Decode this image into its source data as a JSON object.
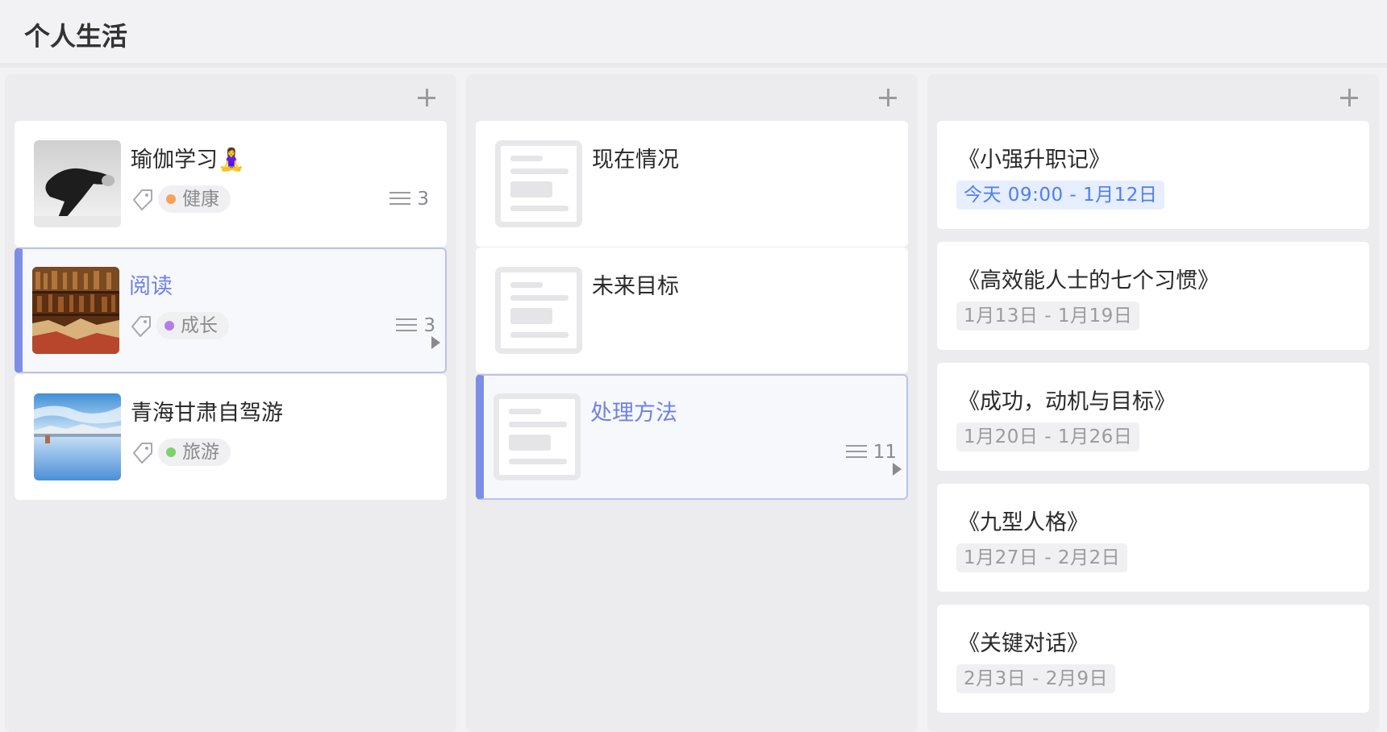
{
  "header": {
    "title": "个人生活"
  },
  "colors": {
    "accent": "#7d8ee6",
    "health": "#f5a35a",
    "growth": "#b27de8",
    "travel": "#7bd36a",
    "today_blue": "#4d7ff0"
  },
  "columns": [
    {
      "add_icon": "plus-icon",
      "cards": [
        {
          "title": "瑜伽学习🧘‍♀️",
          "tag": "健康",
          "count": "3",
          "selected": false,
          "image": "yoga-photo"
        },
        {
          "title": "阅读",
          "tag": "成长",
          "count": "3",
          "selected": true,
          "image": "bookshelf-photo"
        },
        {
          "title": "青海甘肃自驾游",
          "tag": "旅游",
          "count": "",
          "selected": false,
          "image": "lake-photo"
        }
      ]
    },
    {
      "add_icon": "plus-icon",
      "cards": [
        {
          "title": "现在情况",
          "count": "",
          "selected": false,
          "image": "placeholder"
        },
        {
          "title": "未来目标",
          "count": "",
          "selected": false,
          "image": "placeholder"
        },
        {
          "title": "处理方法",
          "count": "11",
          "selected": true,
          "image": "placeholder"
        }
      ]
    },
    {
      "add_icon": "plus-icon",
      "cards": [
        {
          "title": "《小强升职记》",
          "date": "今天 09:00 - 1月12日",
          "today": true
        },
        {
          "title": "《高效能人士的七个习惯》",
          "date": "1月13日 - 1月19日"
        },
        {
          "title": "《成功，动机与目标》",
          "date": "1月20日 - 1月26日"
        },
        {
          "title": "《九型人格》",
          "date": "1月27日 - 2月2日"
        },
        {
          "title": "《关键对话》",
          "date": "2月3日 - 2月9日"
        }
      ]
    }
  ]
}
